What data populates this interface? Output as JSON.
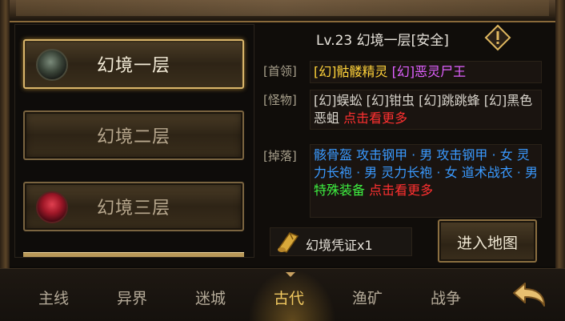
{
  "floors": [
    {
      "label": "幻境一层",
      "active": true,
      "icon": "skull-icon"
    },
    {
      "label": "幻境二层",
      "active": false,
      "icon": ""
    },
    {
      "label": "幻境三层",
      "active": false,
      "icon": "red-demon-icon"
    }
  ],
  "detail": {
    "title": "Lv.23  幻境一层[安全]",
    "boss_label": "[首领]",
    "boss": {
      "a": "[幻]骷髅精灵",
      "b": "[幻]恶灵尸王"
    },
    "monster_label": "[怪物]",
    "monsters": "[幻]蜈蚣 [幻]钳虫 [幻]跳跳蜂 [幻]黑色恶蛆",
    "more": "点击看更多",
    "drop_label": "[掉落]",
    "drops_blue": "骸骨盔 攻击钢甲 · 男 攻击钢甲 · 女 灵力长袍 · 男 灵力长袍 · 女 道术战衣 · 男",
    "drops_green": "特殊装备",
    "drops_more": "点击看更多"
  },
  "ticket": {
    "label": "幻境凭证x1",
    "icon": "scroll-icon"
  },
  "enter_button": "进入地图",
  "tabs": [
    {
      "label": "主线",
      "active": false
    },
    {
      "label": "异界",
      "active": false
    },
    {
      "label": "迷城",
      "active": false
    },
    {
      "label": "古代",
      "active": true
    },
    {
      "label": "渔矿",
      "active": false
    },
    {
      "label": "战争",
      "active": false
    }
  ],
  "colors": {
    "boss": "#ffd23a",
    "elite": "#e060ff",
    "drop": "#3a9aff",
    "special": "#3ef040",
    "more": "#ff3030",
    "active_tab": "#f0c860"
  }
}
